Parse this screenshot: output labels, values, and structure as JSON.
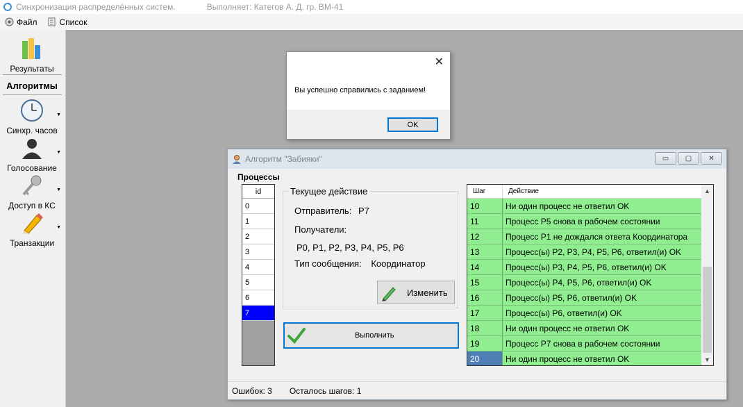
{
  "app": {
    "title": "Синхронизация распределённых систем.",
    "author": "Выполняет:  Категов А. Д.  гр. ВМ-41"
  },
  "menu": [
    {
      "label": "Файл",
      "icon": "gear-icon"
    },
    {
      "label": "Список",
      "icon": "list-icon"
    }
  ],
  "sidebar": {
    "results": "Результаты",
    "header": "Алгоритмы",
    "items": [
      {
        "label": "Синхр. часов",
        "icon": "clock-icon"
      },
      {
        "label": "Голосование",
        "icon": "person-icon"
      },
      {
        "label": "Доступ в КС",
        "icon": "key-icon"
      },
      {
        "label": "Транзакции",
        "icon": "pencil-icon"
      }
    ]
  },
  "message_box": {
    "text": "Вы успешно справились с заданием!",
    "ok_label": "OK"
  },
  "algorithm_window": {
    "title": "Алгоритм \"Забияки\"",
    "processes_label": "Процессы",
    "process_column": "id",
    "process_ids": [
      "0",
      "1",
      "2",
      "3",
      "4",
      "5",
      "6",
      "7"
    ],
    "selected_process": "7",
    "current_action": {
      "title": "Текущее действие",
      "sender_label": "Отправитель:",
      "sender": "P7",
      "receivers_label": "Получатели:",
      "receivers": "P0, P1, P2, P3, P4, P5, P6",
      "msg_type_label": "Тип сообщения:",
      "msg_type": "Координатор",
      "change_label": "Изменить"
    },
    "run_label": "Выполнить",
    "log": {
      "col_step": "Шаг",
      "col_action": "Действие",
      "rows": [
        {
          "step": "10",
          "action": "Ни один процесс не ответил OK"
        },
        {
          "step": "11",
          "action": "Процесс P5 снова в рабочем состоянии"
        },
        {
          "step": "12",
          "action": "Процесс P1 не дождался ответа Координатора"
        },
        {
          "step": "13",
          "action": "Процесс(ы) P2, P3, P4, P5, P6, ответил(и) OK"
        },
        {
          "step": "14",
          "action": "Процесс(ы) P3, P4, P5, P6, ответил(и) OK"
        },
        {
          "step": "15",
          "action": "Процесс(ы) P4, P5, P6, ответил(и) OK"
        },
        {
          "step": "16",
          "action": "Процесс(ы) P5, P6, ответил(и) OK"
        },
        {
          "step": "17",
          "action": "Процесс(ы) P6, ответил(и) OK"
        },
        {
          "step": "18",
          "action": "Ни один процесс не ответил OK"
        },
        {
          "step": "19",
          "action": "Процесс P7 снова в рабочем состоянии"
        },
        {
          "step": "20",
          "action": "Ни один процесс не ответил OK"
        }
      ],
      "current_step": "20"
    },
    "status": {
      "errors": "Ошибок: 3",
      "remaining": "Осталось шагов: 1"
    }
  },
  "colors": {
    "row_green": "#90ee90",
    "selection_blue": "#0000ff",
    "current_step_blue": "#4e7fb5"
  }
}
